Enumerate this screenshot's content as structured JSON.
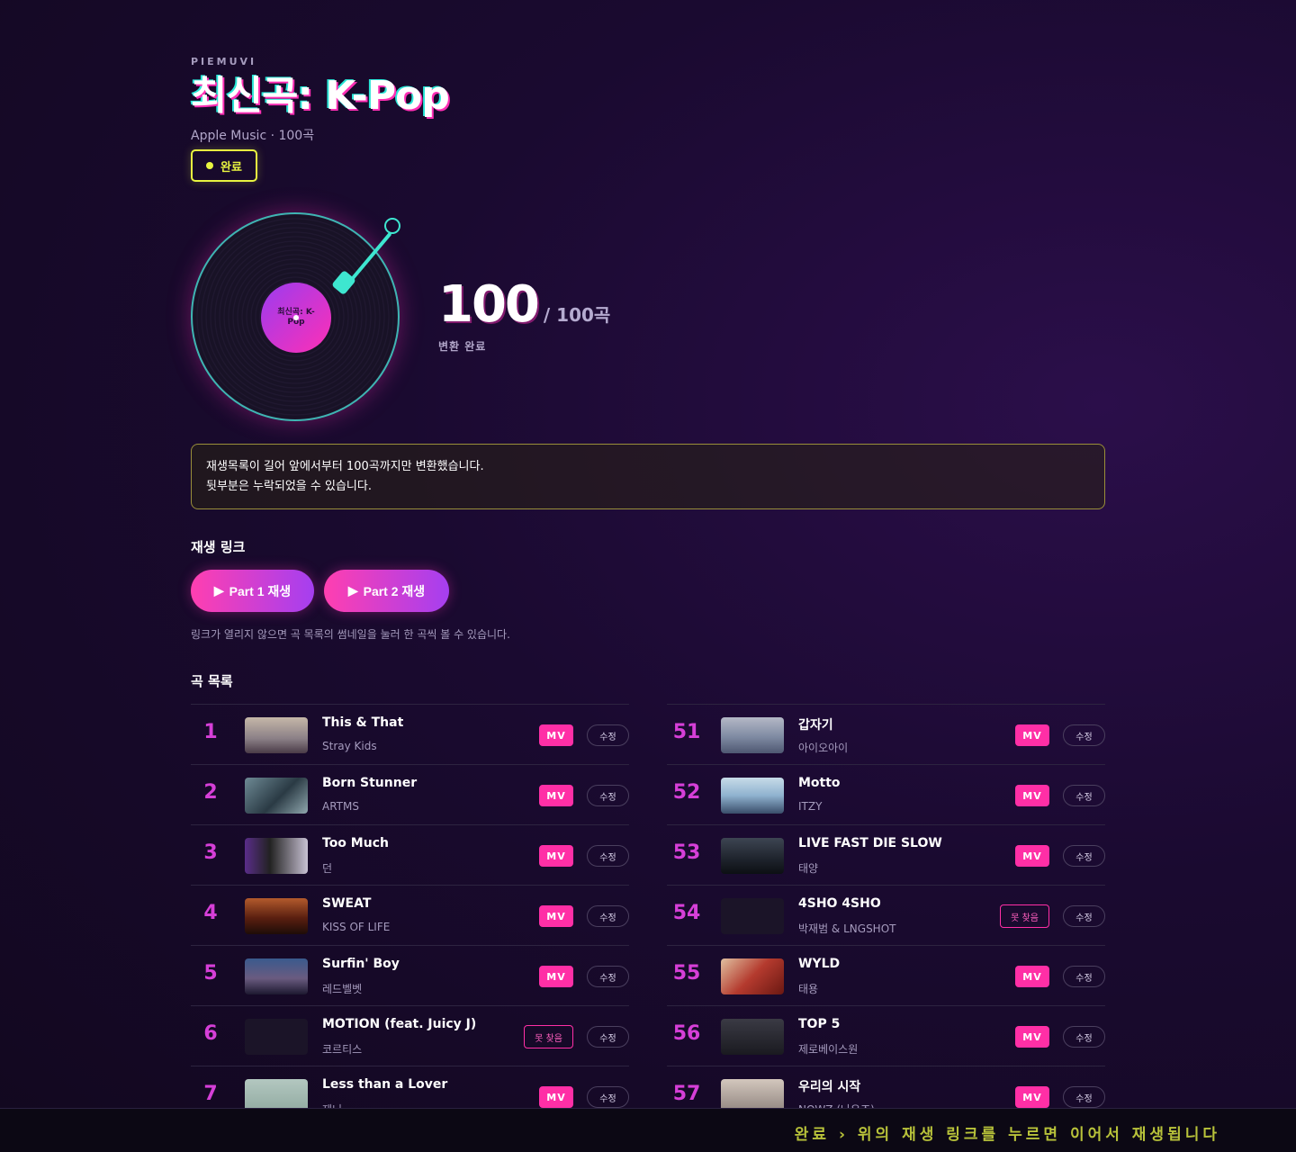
{
  "header": {
    "brand": "PIEMUVI",
    "title": "최신곡: K-Pop",
    "subtitle": "Apple Music · 100곡",
    "status": "완료"
  },
  "vinyl": {
    "label": "최신곡: K-Pop"
  },
  "progress": {
    "count": "100",
    "total": "/ 100곡",
    "label": "변환 완료"
  },
  "notice": {
    "line1": "재생목록이 길어 앞에서부터 100곡까지만 변환했습니다.",
    "line2": "뒷부분은 누락되었을 수 있습니다."
  },
  "play": {
    "title": "재생 링크",
    "part1": "Part 1 재생",
    "part2": "Part 2 재생",
    "hint": "링크가 열리지 않으면 곡 목록의 썸네일을 눌러 한 곡씩 볼 수 있습니다."
  },
  "songs": {
    "title": "곡 목록",
    "mv_label": "MV",
    "notfound_label": "못 찾음",
    "edit_label": "수정",
    "left": [
      {
        "rank": "1",
        "song": "This & That",
        "artist": "Stray Kids"
      },
      {
        "rank": "2",
        "song": "Born Stunner",
        "artist": "ARTMS"
      },
      {
        "rank": "3",
        "song": "Too Much",
        "artist": "던"
      },
      {
        "rank": "4",
        "song": "SWEAT",
        "artist": "KISS OF LIFE"
      },
      {
        "rank": "5",
        "song": "Surfin' Boy",
        "artist": "레드벨벳"
      },
      {
        "rank": "6",
        "song": "MOTION (feat. Juicy J)",
        "artist": "코르티스"
      },
      {
        "rank": "7",
        "song": "Less than a Lover",
        "artist": "제니"
      }
    ],
    "right": [
      {
        "rank": "51",
        "song": "갑자기",
        "artist": "아이오아이"
      },
      {
        "rank": "52",
        "song": "Motto",
        "artist": "ITZY"
      },
      {
        "rank": "53",
        "song": "LIVE FAST DIE SLOW",
        "artist": "태양"
      },
      {
        "rank": "54",
        "song": "4SHO 4SHO",
        "artist": "박재범 & LNGSHOT"
      },
      {
        "rank": "55",
        "song": "WYLD",
        "artist": "태용"
      },
      {
        "rank": "56",
        "song": "TOP 5",
        "artist": "제로베이스원"
      },
      {
        "rank": "57",
        "song": "우리의 시작",
        "artist": "NOWZ (나우즈)"
      }
    ]
  },
  "footer": {
    "text": "완료 › 위의 재생 링크를 누르면 이어서 재생됩니다"
  },
  "colors": {
    "accent_pink": "#ff2fa6",
    "accent_yellow": "#e9f540",
    "accent_teal": "#3ee6d0",
    "rank": "#d63fd8"
  }
}
